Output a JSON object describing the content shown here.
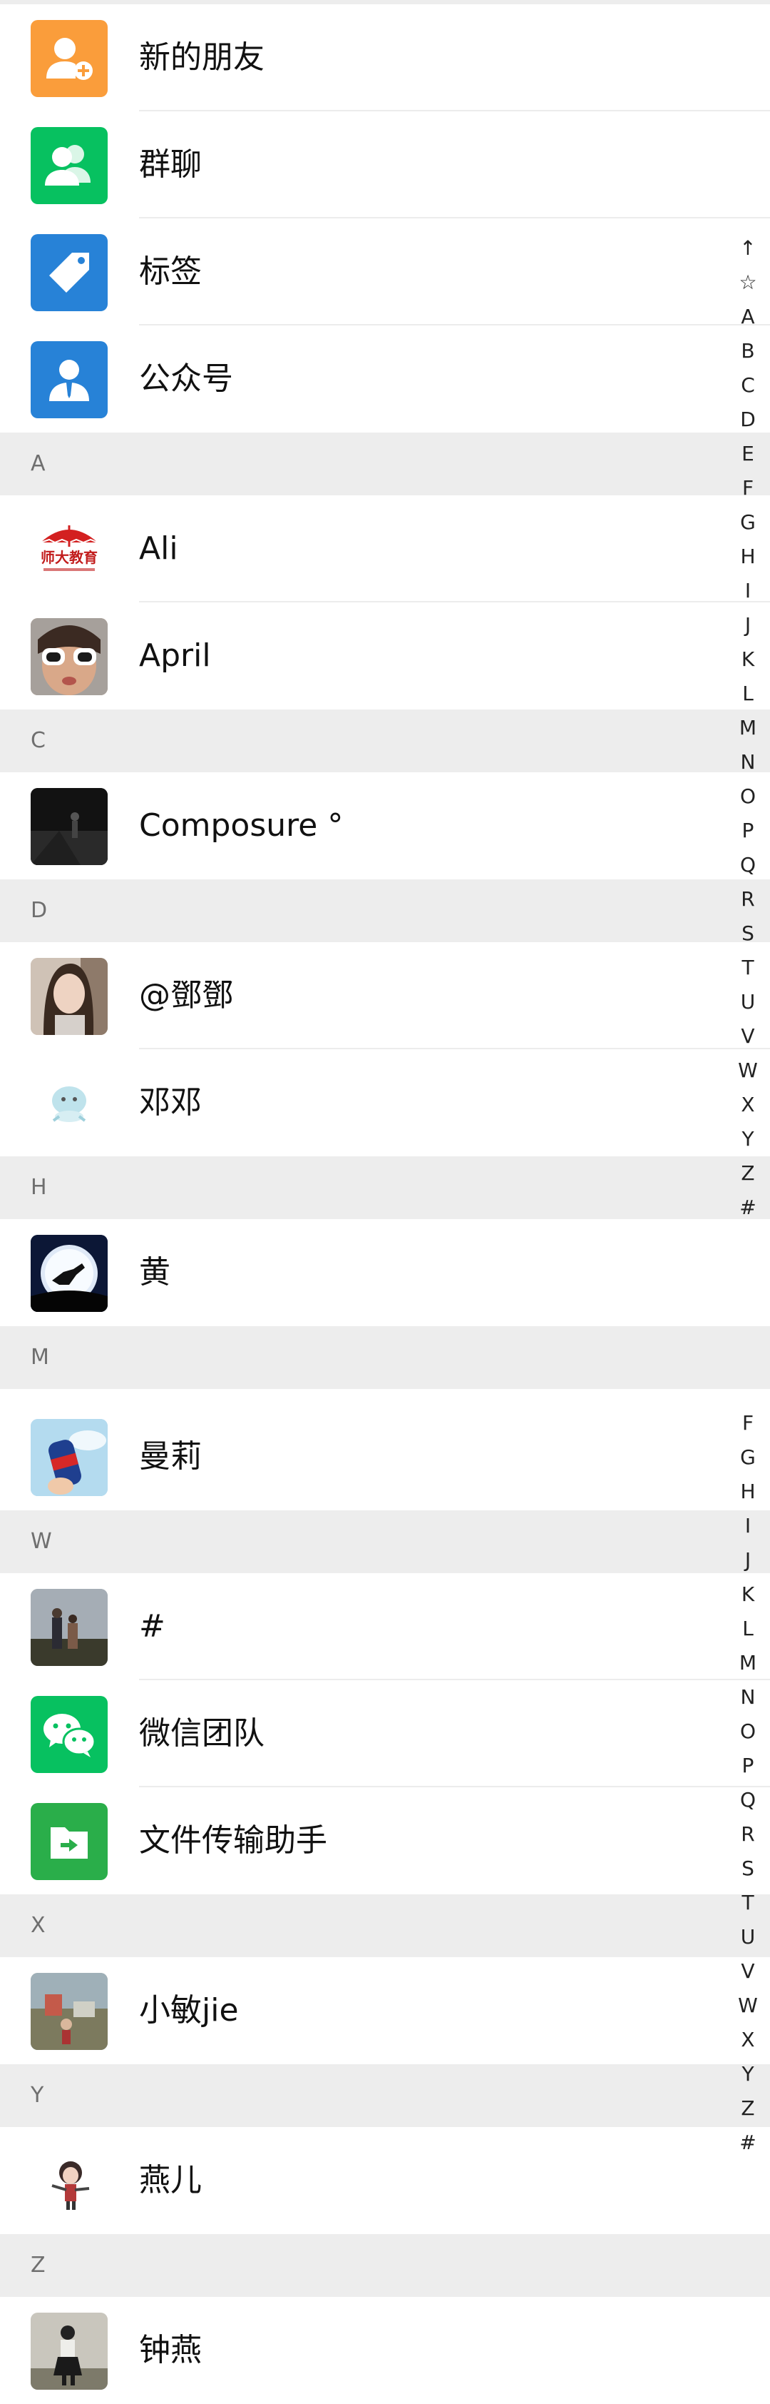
{
  "colors": {
    "orange": "#fa9d3b",
    "green": "#07c160",
    "blue": "#2782d7",
    "section_bg": "#ededed"
  },
  "functions": [
    {
      "label": "新的朋友",
      "icon": "add-friend-icon"
    },
    {
      "label": "群聊",
      "icon": "group-chat-icon"
    },
    {
      "label": "标签",
      "icon": "tag-icon"
    },
    {
      "label": "公众号",
      "icon": "official-account-icon"
    }
  ],
  "sections": {
    "A": "A",
    "C": "C",
    "D": "D",
    "H": "H",
    "M": "M",
    "W": "W",
    "X": "X",
    "Y": "Y",
    "Z": "Z"
  },
  "contacts": {
    "ali": {
      "name": "Ali",
      "avatar_text": "师大教育"
    },
    "april": {
      "name": "April"
    },
    "composure": {
      "name": "Composure °"
    },
    "dengdeng1": {
      "name": "@鄧鄧"
    },
    "dengdeng2": {
      "name": "邓邓"
    },
    "huang": {
      "name": "黄"
    },
    "manli": {
      "name": "曼莉"
    },
    "hash": {
      "name": "#"
    },
    "wechat_team": {
      "name": "微信团队"
    },
    "file_helper": {
      "name": "文件传输助手"
    },
    "xiaomin": {
      "name": "小敏jie"
    },
    "yaner": {
      "name": "燕儿"
    },
    "zhongyan": {
      "name": "钟燕"
    }
  },
  "index_bar_top": [
    "↑",
    "☆",
    "A",
    "B",
    "C",
    "D",
    "E",
    "F",
    "G",
    "H",
    "I",
    "J",
    "K",
    "L",
    "M",
    "N",
    "O",
    "P",
    "Q",
    "R",
    "S",
    "T",
    "U",
    "V",
    "W",
    "X",
    "Y",
    "Z",
    "#"
  ],
  "index_bar_bottom": [
    "F",
    "G",
    "H",
    "I",
    "J",
    "K",
    "L",
    "M",
    "N",
    "O",
    "P",
    "Q",
    "R",
    "S",
    "T",
    "U",
    "V",
    "W",
    "X",
    "Y",
    "Z",
    "#"
  ]
}
